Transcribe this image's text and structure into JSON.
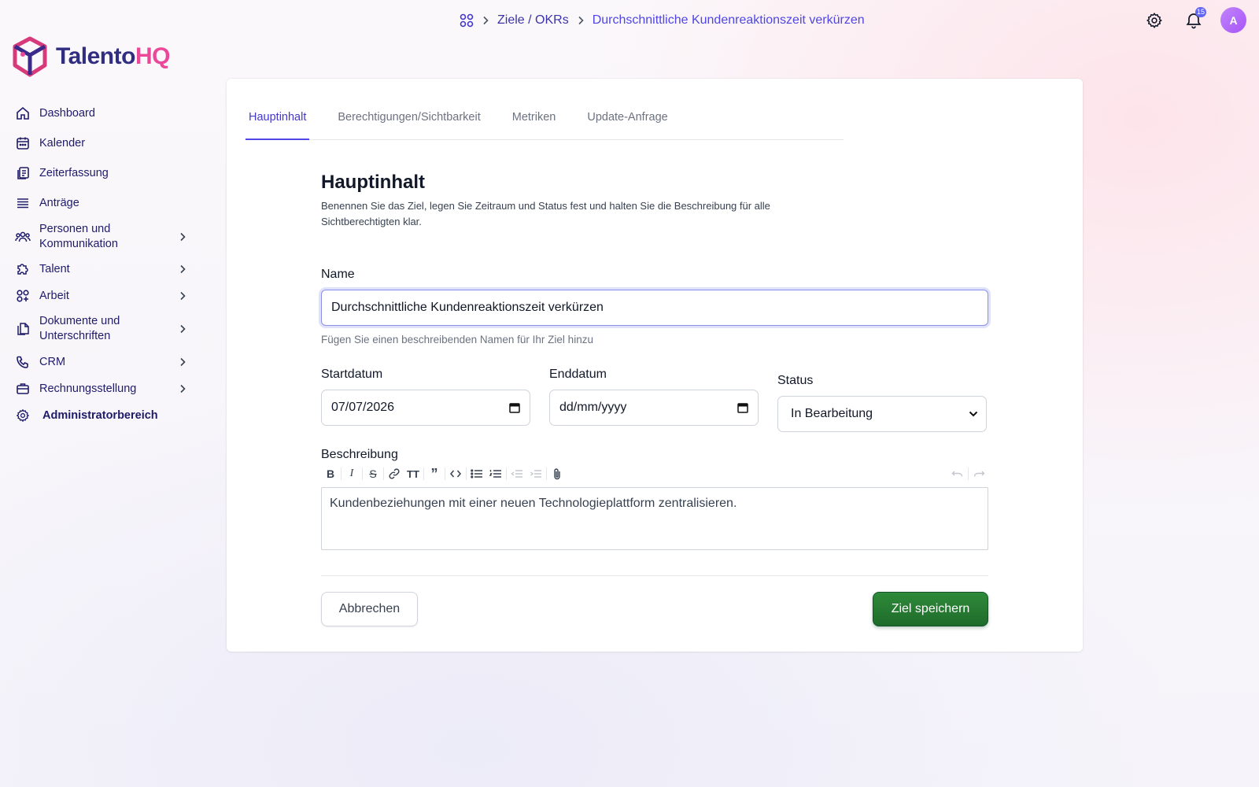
{
  "app": {
    "logo_part1": "Talento",
    "logo_part2": "HQ",
    "logo_icon": "cube-logo-icon"
  },
  "breadcrumb": {
    "home_icon": "grid-icon",
    "items": [
      "Ziele / OKRs",
      "Durchschnittliche Kundenreaktionszeit verkürzen"
    ]
  },
  "header": {
    "settings_icon": "gear-icon",
    "notifications_icon": "bell-icon",
    "notification_count": "15",
    "avatar_initial": "A"
  },
  "sidebar": {
    "items": [
      {
        "label": "Dashboard",
        "icon": "home-icon",
        "has_submenu": false
      },
      {
        "label": "Kalender",
        "icon": "calendar-icon",
        "has_submenu": false
      },
      {
        "label": "Zeiterfassung",
        "icon": "clipboard-icon",
        "has_submenu": false
      },
      {
        "label": "Anträge",
        "icon": "list-icon",
        "has_submenu": false
      },
      {
        "label": "Personen und Kommunikation",
        "icon": "people-icon",
        "has_submenu": true
      },
      {
        "label": "Talent",
        "icon": "puzzle-icon",
        "has_submenu": true
      },
      {
        "label": "Arbeit",
        "icon": "apps-icon",
        "has_submenu": true
      },
      {
        "label": "Dokumente und Unterschriften",
        "icon": "documents-icon",
        "has_submenu": true
      },
      {
        "label": "CRM",
        "icon": "phone-icon",
        "has_submenu": true
      },
      {
        "label": "Rechnungsstellung",
        "icon": "briefcase-icon",
        "has_submenu": true
      },
      {
        "label": "Administratorbereich",
        "icon": "gear-icon",
        "has_submenu": false
      }
    ]
  },
  "tabs": [
    {
      "label": "Hauptinhalt",
      "active": true
    },
    {
      "label": "Berechtigungen/Sichtbarkeit",
      "active": false
    },
    {
      "label": "Metriken",
      "active": false
    },
    {
      "label": "Update-Anfrage",
      "active": false
    }
  ],
  "form": {
    "title": "Hauptinhalt",
    "description": "Benennen Sie das Ziel, legen Sie Zeitraum und Status fest und halten Sie die Beschreibung für alle Sichtberechtigten klar.",
    "name_label": "Name",
    "name_value": "Durchschnittliche Kundenreaktionszeit verkürzen",
    "name_hint": "Fügen Sie einen beschreibenden Namen für Ihr Ziel hinzu",
    "start_label": "Startdatum",
    "start_value": "07/07/2026",
    "end_label": "Enddatum",
    "end_placeholder": "dd/mm/yyyy",
    "status_label": "Status",
    "status_value": "In Bearbeitung",
    "desc_label": "Beschreibung",
    "desc_value": "Kundenbeziehungen mit einer neuen Technologieplattform zentralisieren.",
    "cancel_label": "Abbrechen",
    "save_label": "Ziel speichern"
  },
  "colors": {
    "accent": "#4f46e5",
    "brand_pink": "#ec4899",
    "brand_navy": "#312e81",
    "save_green": "#1e6b2a"
  }
}
